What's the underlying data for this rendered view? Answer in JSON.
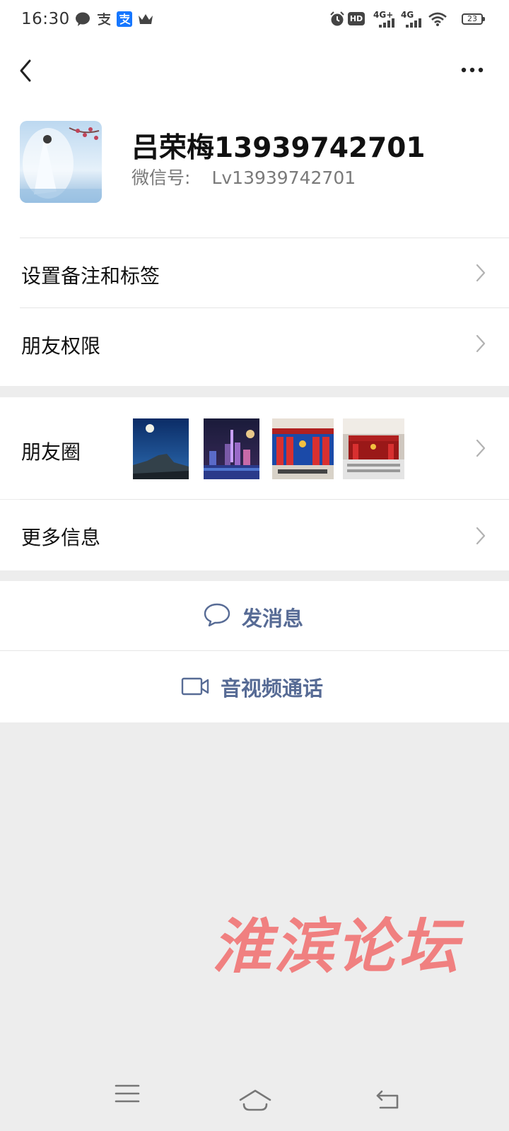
{
  "status_bar": {
    "time": "16:30",
    "network_1": "4G+",
    "network_2": "4G",
    "hd_label": "HD",
    "battery": "23"
  },
  "header": {
    "back_icon": "chevron-left-icon",
    "more_icon": "more-dots-icon"
  },
  "profile": {
    "name": "吕荣梅13939742701",
    "wechat_id_label": "微信号:",
    "wechat_id_value": "Lv13939742701"
  },
  "menu": {
    "remark_tags": "设置备注和标签",
    "friend_permissions": "朋友权限",
    "moments": "朋友圈",
    "more_info": "更多信息"
  },
  "actions": {
    "send_message": "发消息",
    "video_call": "音视频通话"
  },
  "watermark": "淮滨论坛",
  "colors": {
    "link_blue": "#576b95",
    "background": "#ededed",
    "watermark": "#f08080"
  }
}
